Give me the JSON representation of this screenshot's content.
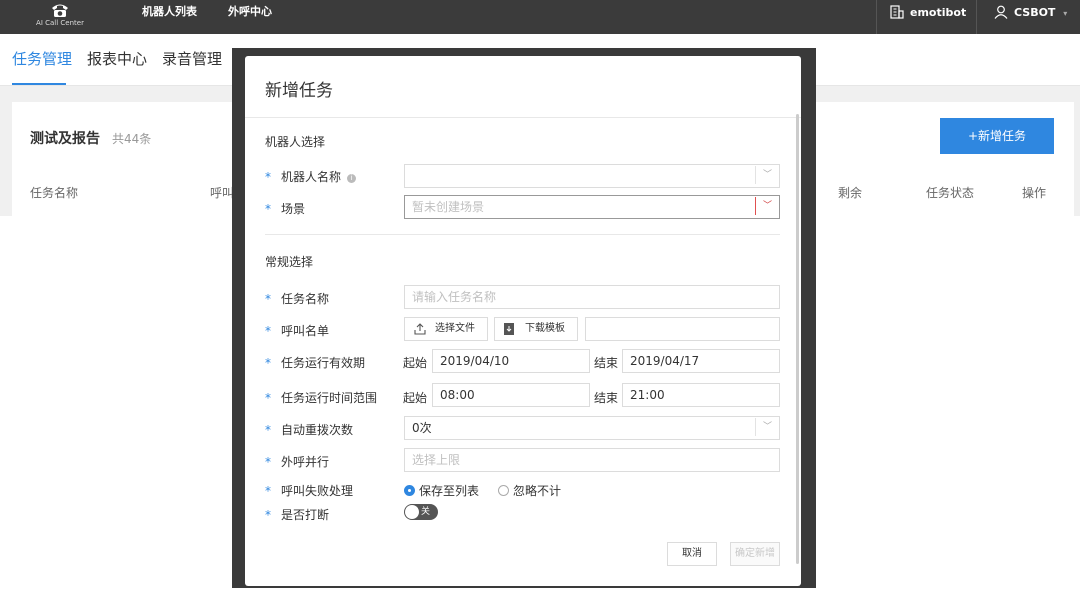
{
  "topbar": {
    "logo_text": "AI Call Center",
    "nav": [
      "机器人列表",
      "外呼中心"
    ],
    "org": "emotibot",
    "user": "CSBOT"
  },
  "tabs": [
    {
      "label": "任务管理",
      "active": true
    },
    {
      "label": "报表中心",
      "active": false
    },
    {
      "label": "录音管理",
      "active": false
    }
  ],
  "panel": {
    "title": "测试及报告",
    "count": "共44条",
    "add_button": "+新增任务",
    "columns": [
      "任务名称",
      "呼叫",
      "剩余",
      "任务状态",
      "操作"
    ]
  },
  "modal": {
    "title": "新增任务",
    "section_robot": "机器人选择",
    "robot_name_label": "机器人名称",
    "robot_name_value": "",
    "scene_label": "场景",
    "scene_placeholder": "暂未创建场景",
    "section_general": "常规选择",
    "task_name_label": "任务名称",
    "task_name_placeholder": "请输入任务名称",
    "call_list_label": "呼叫名单",
    "choose_file": "选择文件",
    "download_template": "下载模板",
    "validity_label": "任务运行有效期",
    "validity_start_prefix": "起始",
    "validity_start": "2019/04/10",
    "validity_end_prefix": "结束",
    "validity_end": "2019/04/17",
    "time_range_label": "任务运行时间范围",
    "time_start_prefix": "起始",
    "time_start": "08:00",
    "time_end_prefix": "结束",
    "time_end": "21:00",
    "redial_label": "自动重拨次数",
    "redial_value": "0次",
    "concurrency_label": "外呼并行",
    "concurrency_placeholder": "选择上限",
    "fail_label": "呼叫失败处理",
    "fail_options": [
      {
        "label": "保存至列表",
        "checked": true
      },
      {
        "label": "忽略不计",
        "checked": false
      }
    ],
    "interrupt_label": "是否打断",
    "interrupt_toggle": "关",
    "cancel": "取消",
    "confirm": "确定新增"
  },
  "colors": {
    "accent": "#2f87e0",
    "topbar": "#3b3b3b",
    "overlay": "#3a3a3a"
  }
}
